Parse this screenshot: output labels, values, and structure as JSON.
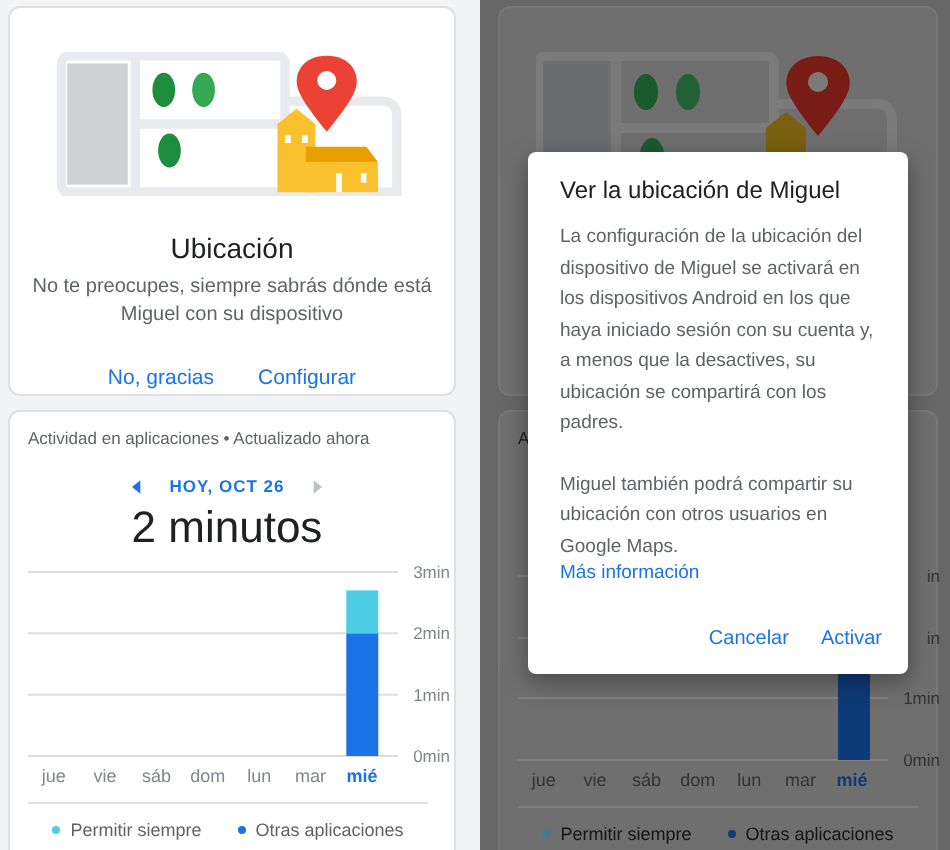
{
  "left_screen": {
    "location_card": {
      "title": "Ubicación",
      "description": "No te preocupes, siempre sabrás dónde está Miguel con su dispositivo",
      "buttons": [
        {
          "label": "No, gracias"
        },
        {
          "label": "Configurar"
        }
      ]
    },
    "activity_card": {
      "header": "Actividad en aplicaciones • Actualizado ahora",
      "date": {
        "label": "HOY, OCT 26",
        "previous_enabled": true,
        "next_enabled": false
      },
      "total": "2 minutos",
      "chart_data": {
        "type": "bar",
        "stacked": true,
        "categories": [
          "jue",
          "vie",
          "sáb",
          "dom",
          "lun",
          "mar",
          "mié"
        ],
        "ylim": [
          0,
          3
        ],
        "yticks": [
          {
            "value": 0,
            "label": "0min"
          },
          {
            "value": 1,
            "label": "1min"
          },
          {
            "value": 2,
            "label": "2min"
          },
          {
            "value": 3,
            "label": "3min"
          }
        ],
        "series": [
          {
            "name": "Permitir siempre",
            "color": "#4ecde6",
            "values": [
              0,
              0,
              0,
              0,
              0,
              0,
              0.7
            ]
          },
          {
            "name": "Otras aplicaciones",
            "color": "#1a73e8",
            "values": [
              0,
              0,
              0,
              0,
              0,
              0,
              2
            ]
          }
        ]
      },
      "day_selected": [
        false,
        false,
        false,
        false,
        false,
        false,
        true
      ]
    }
  },
  "right_screen": {
    "activity_card": {
      "header": "A",
      "tick_labels": [
        "in",
        "in",
        "1min",
        "0min"
      ],
      "days": [
        {
          "label": "jue",
          "selected": false
        },
        {
          "label": "vie",
          "selected": false
        },
        {
          "label": "sáb",
          "selected": false
        },
        {
          "label": "dom",
          "selected": false
        },
        {
          "label": "lun",
          "selected": false
        },
        {
          "label": "mar",
          "selected": false
        },
        {
          "label": "mié",
          "selected": true
        }
      ],
      "legend": [
        {
          "label": "Permitir siempre",
          "color": "#3e7f8c"
        },
        {
          "label": "Otras aplicaciones",
          "color": "#0d3a78"
        }
      ]
    },
    "dialog": {
      "title": "Ver la ubicación de Miguel",
      "paragraphs": [
        "La configuración de la ubicación del dispositivo de Miguel se activará en los dispositivos Android en los que haya iniciado sesión con su cuenta y, a menos que la desactives, su ubicación se compartirá con los padres.",
        "Miguel también podrá compartir su ubicación con otros usuarios en Google Maps."
      ],
      "link": "Más información",
      "buttons": [
        {
          "label": "Cancelar"
        },
        {
          "label": "Activar"
        }
      ]
    }
  }
}
